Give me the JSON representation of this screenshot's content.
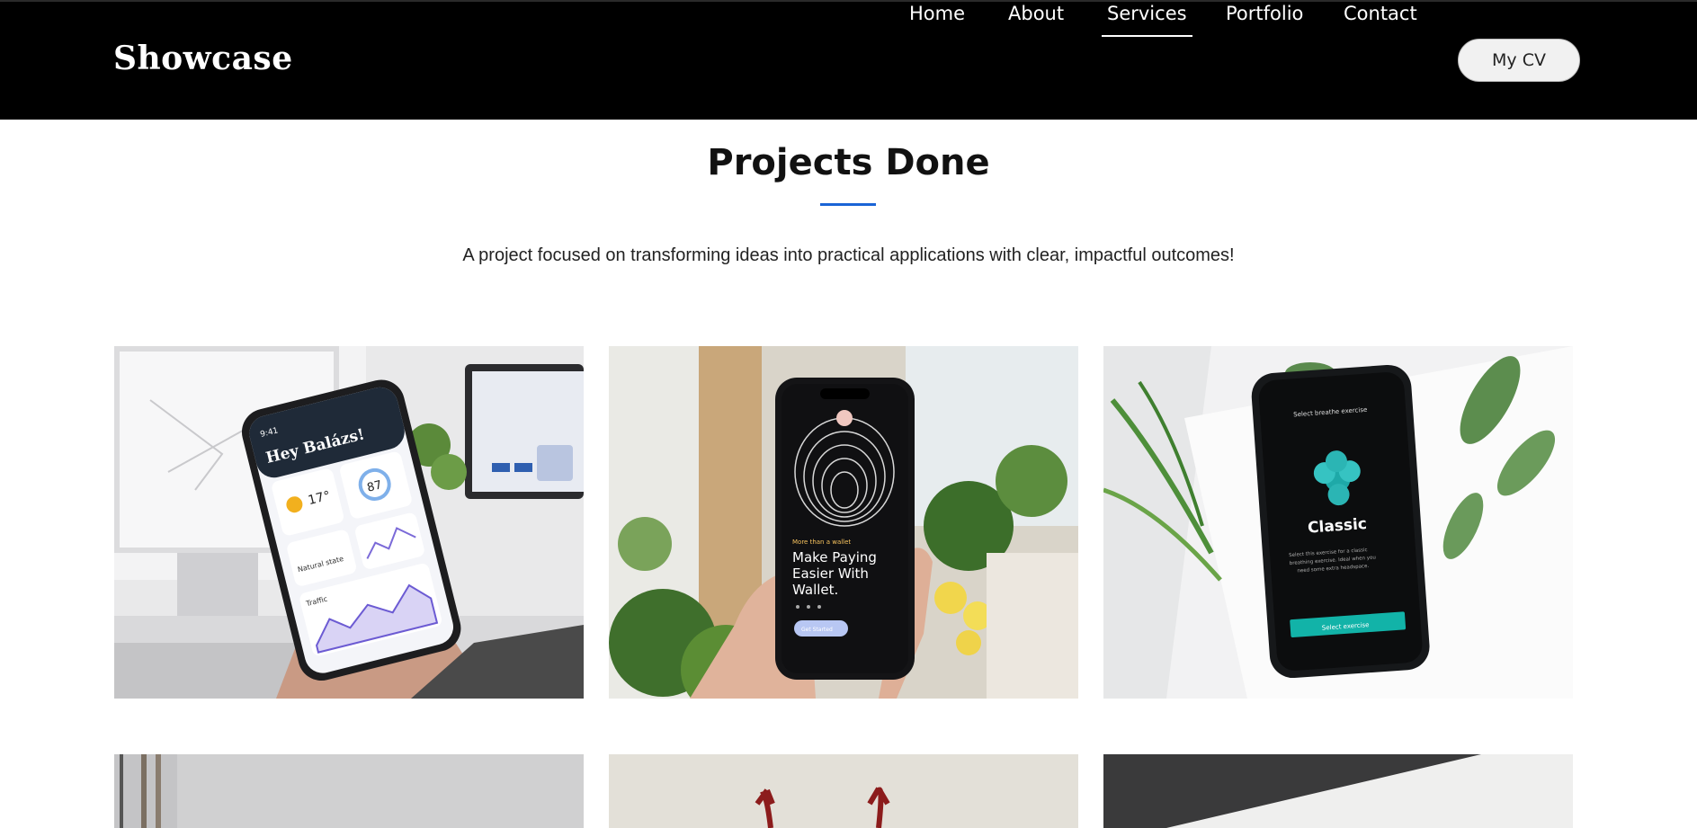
{
  "header": {
    "logo": "Showcase",
    "nav": [
      {
        "label": "Home",
        "active": false
      },
      {
        "label": "About",
        "active": false
      },
      {
        "label": "Services",
        "active": true
      },
      {
        "label": "Portfolio",
        "active": false
      },
      {
        "label": "Contact",
        "active": false
      }
    ],
    "cv_button": "My CV"
  },
  "section": {
    "title": "Projects Done",
    "subtitle": "A project focused on transforming ideas into practical applications with clear, impactful outcomes!"
  },
  "projects": [
    {
      "phone_screen": {
        "greeting": "Hey Balázs!",
        "temp": "17°",
        "aq": "87",
        "time": "9:41",
        "label_traffic": "Traffic",
        "label_quality": "Natural state"
      }
    },
    {
      "phone_screen": {
        "tagline": "More than a wallet",
        "headline_1": "Make Paying",
        "headline_2": "Easier With",
        "headline_3": "Wallet.",
        "cta": "Get Started"
      }
    },
    {
      "phone_screen": {
        "top": "Select breathe exercise",
        "title": "Classic",
        "desc_1": "Select this exercise for a classic",
        "desc_2": "breathing exercise. Ideal when you",
        "desc_3": "need some extra headspace.",
        "cta": "Select exercise"
      }
    },
    {},
    {},
    {}
  ],
  "colors": {
    "accent": "#1a64d6",
    "header_bg": "#000000",
    "teal": "#12b3a8"
  }
}
